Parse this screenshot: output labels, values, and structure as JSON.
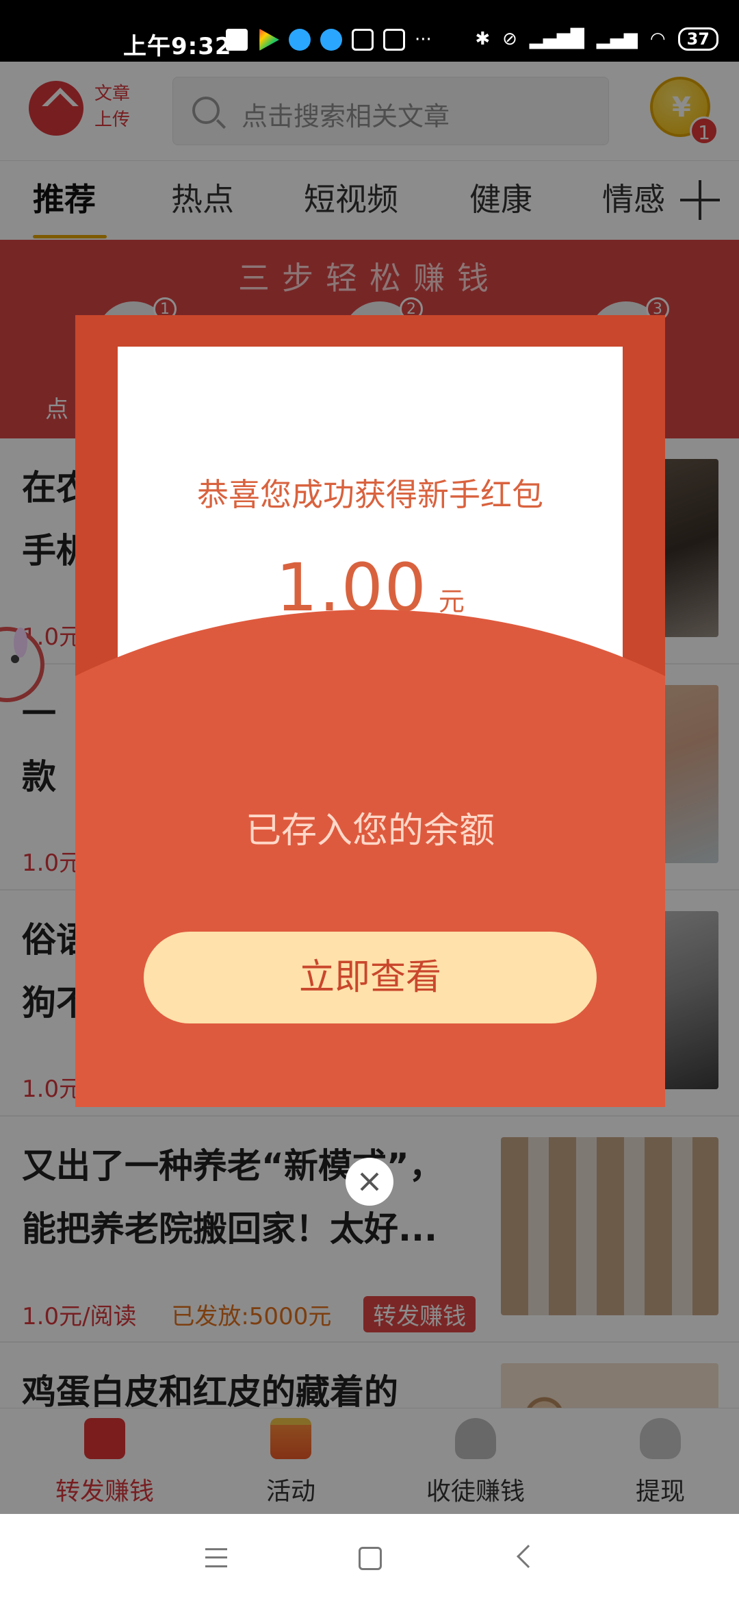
{
  "status_bar": {
    "time": "上午9:32",
    "battery": "37"
  },
  "header": {
    "upload_text": "文章上传",
    "search_placeholder": "点击搜索相关文章",
    "coin_badge": "1"
  },
  "tabs": [
    {
      "label": "推荐",
      "active": true
    },
    {
      "label": "热点"
    },
    {
      "label": "短视频"
    },
    {
      "label": "健康"
    },
    {
      "label": "情感"
    }
  ],
  "banner": {
    "title": "三步轻松赚钱",
    "steps": [
      "1",
      "2",
      "3"
    ],
    "label": "点"
  },
  "feed": [
    {
      "title": "在农\n手机",
      "price": "1.0元"
    },
    {
      "title": "一\n款",
      "price": "1.0元"
    },
    {
      "title": "俗语\n狗不",
      "price": "1.0元"
    },
    {
      "title": "又出了一种养老“新模式”，\n能把养老院搬回家！太好...",
      "price": "1.0元/阅读",
      "issued": "已发放:5000元",
      "tag": "转发赚钱"
    },
    {
      "title": "鸡蛋白皮和红皮的藏着的"
    }
  ],
  "modal": {
    "message": "恭喜您成功获得新手红包",
    "amount": "1.00",
    "unit": "元",
    "sub": "已存入您的余额",
    "button": "立即查看"
  },
  "bottom_nav": [
    {
      "label": "转发赚钱",
      "icon": "news-icon",
      "active": true
    },
    {
      "label": "活动",
      "icon": "gift-icon"
    },
    {
      "label": "收徒赚钱",
      "icon": "user-icon"
    },
    {
      "label": "提现",
      "icon": "wallet-icon"
    }
  ],
  "colors": {
    "brand_red": "#d9373c",
    "packet_red": "#c9472c",
    "button_cream": "#ffe1ab"
  }
}
